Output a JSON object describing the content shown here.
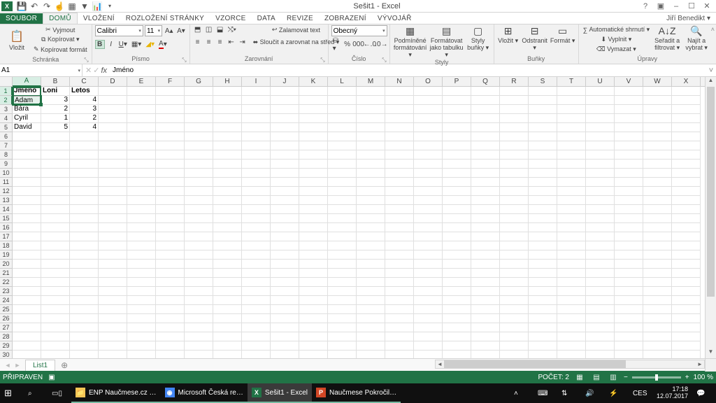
{
  "titlebar": {
    "title": "Sešit1 - Excel",
    "qat_icons": [
      "save-icon",
      "undo-icon",
      "redo-icon",
      "touch-icon",
      "table-icon",
      "filter-icon",
      "chart-icon",
      "dropdown-icon"
    ]
  },
  "window_buttons": {
    "help": "?",
    "ribbon_opts": "▣",
    "min": "–",
    "max": "☐",
    "close": "✕"
  },
  "user": "Jiří Benedikt ▾",
  "tabs": [
    "SOUBOR",
    "DOMŮ",
    "VLOŽENÍ",
    "ROZLOŽENÍ STRÁNKY",
    "VZORCE",
    "DATA",
    "REVIZE",
    "ZOBRAZENÍ",
    "VÝVOJÁŘ"
  ],
  "active_tab": 1,
  "ribbon": {
    "groups": [
      "Schránka",
      "Písmo",
      "Zarovnání",
      "Číslo",
      "Styly",
      "Buňky",
      "Úpravy"
    ],
    "clipboard": {
      "paste": "Vložit",
      "cut": "Vyjmout",
      "copy": "Kopírovat ▾",
      "format_painter": "Kopírovat formát"
    },
    "font": {
      "name": "Calibri",
      "size": "11"
    },
    "alignment": {
      "wrap": "Zalamovat text",
      "merge": "Sloučit a zarovnat na střed ▾"
    },
    "number": {
      "format": "Obecný"
    },
    "styles": {
      "cond": "Podmíněné formátování ▾",
      "table": "Formátovat jako tabulku ▾",
      "cell": "Styly buňky ▾"
    },
    "cells": {
      "insert": "Vložit ▾",
      "delete": "Odstranit ▾",
      "format": "Formát ▾"
    },
    "editing": {
      "autosum": "Automatické shrnutí ▾",
      "fill": "Vyplnit ▾",
      "clear": "Vymazat ▾",
      "sort": "Seřadit a filtrovat ▾",
      "find": "Najít a vybrat ▾"
    }
  },
  "namebox": "A1",
  "formula": "Jméno",
  "columns": [
    "A",
    "B",
    "C",
    "D",
    "E",
    "F",
    "G",
    "H",
    "I",
    "J",
    "K",
    "L",
    "M",
    "N",
    "O",
    "P",
    "Q",
    "R",
    "S",
    "T",
    "U",
    "V",
    "W",
    "X"
  ],
  "rows": 30,
  "sheet_data": {
    "headers": [
      "Jméno",
      "Loni",
      "Letos"
    ],
    "rows": [
      [
        "Adam",
        "3",
        "4"
      ],
      [
        "Bára",
        "2",
        "3"
      ],
      [
        "Cyril",
        "1",
        "2"
      ],
      [
        "David",
        "5",
        "4"
      ]
    ]
  },
  "selection": {
    "col": 0,
    "row_start": 0,
    "row_end": 1
  },
  "sheets": {
    "active": "List1"
  },
  "status": {
    "ready": "PŘIPRAVEN",
    "count_label": "POČET: 2",
    "zoom": "100 %"
  },
  "taskbar": {
    "apps": [
      {
        "icon": "📁",
        "color": "#f7c656",
        "label": "ENP Naučmese.cz …"
      },
      {
        "icon": "◉",
        "color": "#4285f4",
        "label": "Microsoft Česká re…"
      },
      {
        "icon": "X",
        "color": "#217346",
        "label": "Sešit1 - Excel",
        "active": true
      },
      {
        "icon": "P",
        "color": "#d24726",
        "label": "Naučmese Pokročil…"
      }
    ],
    "time": "17:18",
    "date": "12.07.2017",
    "lang": "CES"
  }
}
